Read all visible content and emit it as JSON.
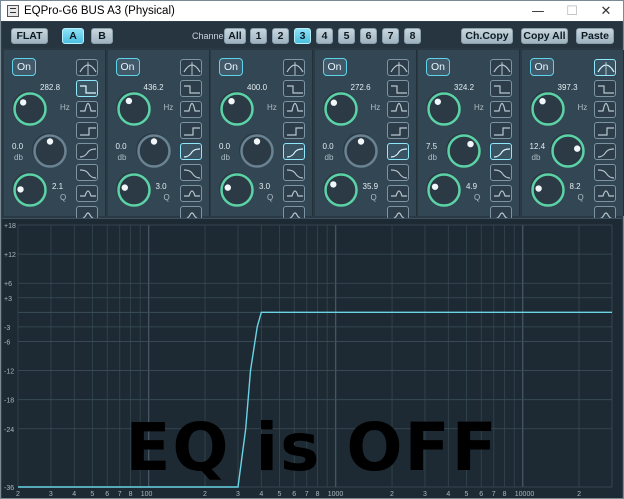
{
  "window": {
    "title": "EQPro-G6 BUS A3 (Physical)",
    "minimize": "—",
    "maximize": "☐",
    "close": "✕"
  },
  "toolbar": {
    "flat": "FLAT",
    "presetA": "A",
    "presetB": "B",
    "channel_label": "Channel:",
    "channel_all": "All",
    "channels": [
      "1",
      "2",
      "3",
      "4",
      "5",
      "6",
      "7",
      "8"
    ],
    "selected_channel": "3",
    "ch_copy": "Ch.Copy",
    "copy_all": "Copy All",
    "paste": "Paste"
  },
  "bands": [
    {
      "on": "On",
      "freq": "282.8",
      "freq_unit": "Hz",
      "gain": "0.0",
      "gain_unit": "db",
      "q": "2.1",
      "q_unit": "Q",
      "filter": "low-shelf",
      "freq_level": 0.33,
      "gain_level": 0.5,
      "q_level": 0.18
    },
    {
      "on": "On",
      "freq": "436.2",
      "freq_unit": "Hz",
      "gain": "0.0",
      "gain_unit": "db",
      "q": "3.0",
      "q_unit": "Q",
      "filter": "high-pass",
      "freq_level": 0.38,
      "gain_level": 0.5,
      "q_level": 0.22
    },
    {
      "on": "On",
      "freq": "400.0",
      "freq_unit": "Hz",
      "gain": "0.0",
      "gain_unit": "db",
      "q": "3.0",
      "q_unit": "Q",
      "filter": "high-pass",
      "freq_level": 0.37,
      "gain_level": 0.5,
      "q_level": 0.22
    },
    {
      "on": "On",
      "freq": "272.6",
      "freq_unit": "Hz",
      "gain": "0.0",
      "gain_unit": "db",
      "q": "35.9",
      "q_unit": "Q",
      "filter": "high-pass",
      "freq_level": 0.32,
      "gain_level": 0.5,
      "q_level": 0.3
    },
    {
      "on": "On",
      "freq": "324.2",
      "freq_unit": "Hz",
      "gain": "7.5",
      "gain_unit": "db",
      "q": "4.9",
      "q_unit": "Q",
      "filter": "high-pass",
      "freq_level": 0.35,
      "gain_level": 0.66,
      "q_level": 0.24
    },
    {
      "on": "On",
      "freq": "397.3",
      "freq_unit": "Hz",
      "gain": "12.4",
      "gain_unit": "db",
      "q": "8.2",
      "q_unit": "Q",
      "filter": "band-pass",
      "freq_level": 0.37,
      "gain_level": 0.78,
      "q_level": 0.2
    }
  ],
  "graph": {
    "db_ticks": [
      "+18",
      "+12",
      "+6",
      "+3",
      "-3",
      "-6",
      "-12",
      "-18",
      "-24",
      "-36"
    ],
    "freq_labels": [
      "2",
      "3",
      "4",
      "5",
      "6",
      "7",
      "8",
      "100",
      "2",
      "3",
      "4",
      "5",
      "6",
      "7",
      "8",
      "1000",
      "2",
      "3",
      "4",
      "5",
      "6",
      "7",
      "8",
      "10000",
      "2"
    ],
    "overlay_text": "EQ is OFF",
    "curve_color": "#6ad3e4"
  },
  "chart_data": {
    "type": "line",
    "xlabel": "",
    "ylabel": "",
    "x_scale": "log",
    "x": [
      20,
      300,
      330,
      350,
      380,
      400,
      30000
    ],
    "series": [
      {
        "values": [
          -36,
          -36,
          -24,
          -12,
          -3,
          0,
          0
        ]
      }
    ],
    "ylim": [
      -36,
      18
    ]
  }
}
